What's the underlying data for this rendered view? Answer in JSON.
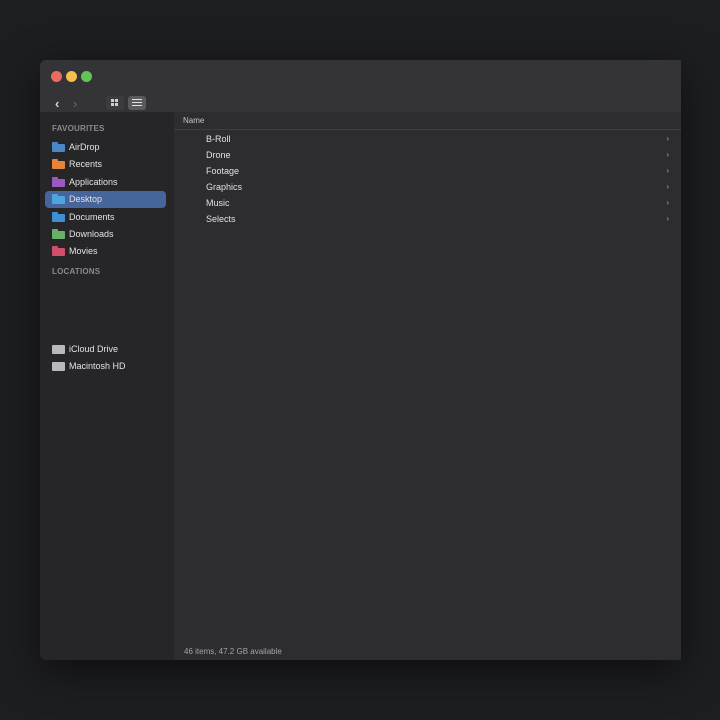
{
  "toolbar": {
    "back_glyph": "‹",
    "forward_glyph": "›",
    "view_icons_icon": "grid-icon",
    "view_list_icon": "list-icon"
  },
  "sidebar": {
    "favourites_title": "FAVOURITES",
    "favourites": [
      {
        "label": "AirDrop",
        "color": "#4a86c8",
        "selected": false
      },
      {
        "label": "Recents",
        "color": "#e8843a",
        "selected": false
      },
      {
        "label": "Applications",
        "color": "#9a58c0",
        "selected": false
      },
      {
        "label": "Desktop",
        "color": "#4fa3e0",
        "selected": true
      },
      {
        "label": "Documents",
        "color": "#3e8fd6",
        "selected": false
      },
      {
        "label": "Downloads",
        "color": "#66b06a",
        "selected": false
      },
      {
        "label": "Movies",
        "color": "#cf4f6a",
        "selected": false
      }
    ],
    "locations_title": "LOCATIONS",
    "locations": [
      {
        "label": "iCloud Drive"
      },
      {
        "label": "Macintosh HD"
      }
    ]
  },
  "main": {
    "column_name": "Name",
    "rows": [
      {
        "name": "B-Roll",
        "chevron": "›"
      },
      {
        "name": "Drone",
        "chevron": "›"
      },
      {
        "name": "Footage",
        "chevron": "›"
      },
      {
        "name": "Graphics",
        "chevron": "›"
      },
      {
        "name": "Music",
        "chevron": "›"
      },
      {
        "name": "Selects",
        "chevron": "›"
      }
    ]
  },
  "status": {
    "text": "46 items, 47.2 GB available"
  },
  "colors": {
    "selection": "#46659b",
    "window_bg": "#2c2c2e",
    "sidebar_bg": "#262628"
  }
}
